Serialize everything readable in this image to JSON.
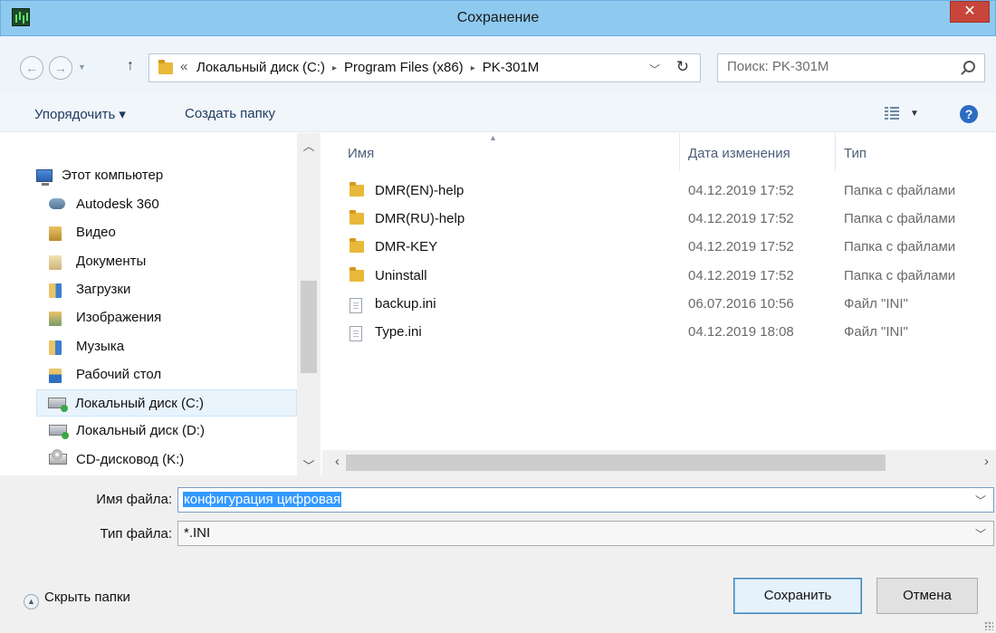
{
  "window": {
    "title": "Сохранение",
    "close_label": "✕"
  },
  "address": {
    "overflow_chevron": "«",
    "crumbs": [
      "Локальный диск (C:)",
      "Program Files (x86)",
      "PK-301M"
    ],
    "separator": "▸"
  },
  "search": {
    "placeholder": "Поиск: PK-301M"
  },
  "toolbar": {
    "organize_label": "Упорядочить ▾",
    "new_folder_label": "Создать папку",
    "help_label": "?"
  },
  "sidebar": {
    "items": [
      {
        "label": "Этот компьютер",
        "icon": "computer-icon"
      },
      {
        "label": "Autodesk 360",
        "icon": "cloud-icon"
      },
      {
        "label": "Видео",
        "icon": "videos-folder-icon"
      },
      {
        "label": "Документы",
        "icon": "documents-folder-icon"
      },
      {
        "label": "Загрузки",
        "icon": "downloads-folder-icon"
      },
      {
        "label": "Изображения",
        "icon": "pictures-folder-icon"
      },
      {
        "label": "Музыка",
        "icon": "music-folder-icon"
      },
      {
        "label": "Рабочий стол",
        "icon": "desktop-folder-icon"
      },
      {
        "label": "Локальный диск (C:)",
        "icon": "drive-icon",
        "selected": true
      },
      {
        "label": "Локальный диск (D:)",
        "icon": "drive-icon"
      },
      {
        "label": "CD-дисковод (K:)",
        "icon": "cd-drive-icon"
      }
    ]
  },
  "file_list": {
    "columns": [
      "Имя",
      "Дата изменения",
      "Тип"
    ],
    "rows": [
      {
        "name": "DMR(EN)-help",
        "date": "04.12.2019 17:52",
        "type": "Папка с файлами",
        "icon": "folder-icon"
      },
      {
        "name": "DMR(RU)-help",
        "date": "04.12.2019 17:52",
        "type": "Папка с файлами",
        "icon": "folder-icon"
      },
      {
        "name": "DMR-KEY",
        "date": "04.12.2019 17:52",
        "type": "Папка с файлами",
        "icon": "folder-icon"
      },
      {
        "name": "Uninstall",
        "date": "04.12.2019 17:52",
        "type": "Папка с файлами",
        "icon": "folder-icon"
      },
      {
        "name": "backup.ini",
        "date": "06.07.2016 10:56",
        "type": "Файл \"INI\"",
        "icon": "file-icon"
      },
      {
        "name": "Type.ini",
        "date": "04.12.2019 18:08",
        "type": "Файл \"INI\"",
        "icon": "file-icon"
      }
    ]
  },
  "form": {
    "filename_label": "Имя файла:",
    "filename_value": "конфигурация цифровая",
    "filetype_label": "Тип файла:",
    "filetype_value": "*.INI",
    "hide_folders_label": "Скрыть папки",
    "save_label": "Сохранить",
    "cancel_label": "Отмена"
  },
  "colors": {
    "titlebar": "#8ec9f0",
    "close_button": "#c7453b",
    "selection": "#3399ff",
    "nav_selected": "#e8f3fc"
  }
}
